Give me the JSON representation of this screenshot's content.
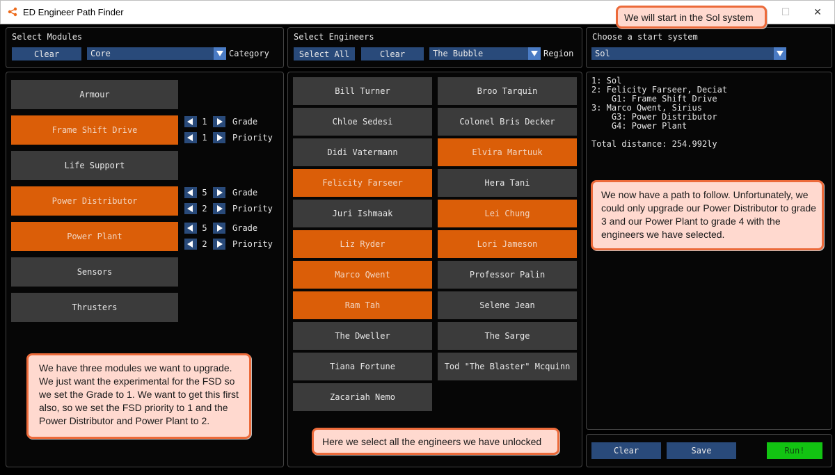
{
  "window": {
    "title": "ED Engineer Path Finder",
    "minimize": "—",
    "maximize": "☐",
    "close": "✕"
  },
  "modules_header": {
    "title": "Select Modules",
    "clear": "Clear",
    "category_value": "Core",
    "category_label": "Category"
  },
  "modules": [
    {
      "name": "Armour",
      "selected": false
    },
    {
      "name": "Frame Shift Drive",
      "selected": true,
      "grade": "1",
      "priority": "1"
    },
    {
      "name": "Life Support",
      "selected": false
    },
    {
      "name": "Power Distributor",
      "selected": true,
      "grade": "5",
      "priority": "2"
    },
    {
      "name": "Power Plant",
      "selected": true,
      "grade": "5",
      "priority": "2"
    },
    {
      "name": "Sensors",
      "selected": false
    },
    {
      "name": "Thrusters",
      "selected": false
    }
  ],
  "grade_label": "Grade",
  "priority_label": "Priority",
  "engineers_header": {
    "title": "Select Engineers",
    "select_all": "Select All",
    "clear": "Clear",
    "region_value": "The Bubble",
    "region_label": "Region"
  },
  "engineers": [
    {
      "name": "Bill Turner",
      "selected": false
    },
    {
      "name": "Broo Tarquin",
      "selected": false
    },
    {
      "name": "Chloe Sedesi",
      "selected": false
    },
    {
      "name": "Colonel Bris Decker",
      "selected": false
    },
    {
      "name": "Didi Vatermann",
      "selected": false
    },
    {
      "name": "Elvira Martuuk",
      "selected": true
    },
    {
      "name": "Felicity Farseer",
      "selected": true
    },
    {
      "name": "Hera Tani",
      "selected": false
    },
    {
      "name": "Juri Ishmaak",
      "selected": false
    },
    {
      "name": "Lei Chung",
      "selected": true
    },
    {
      "name": "Liz Ryder",
      "selected": true
    },
    {
      "name": "Lori Jameson",
      "selected": true
    },
    {
      "name": "Marco Qwent",
      "selected": true
    },
    {
      "name": "Professor Palin",
      "selected": false
    },
    {
      "name": "Ram Tah",
      "selected": true
    },
    {
      "name": "Selene Jean",
      "selected": false
    },
    {
      "name": "The Dweller",
      "selected": false
    },
    {
      "name": "The Sarge",
      "selected": false
    },
    {
      "name": "Tiana Fortune",
      "selected": false
    },
    {
      "name": "Tod \"The Blaster\" Mcquinn",
      "selected": false
    },
    {
      "name": "Zacariah Nemo",
      "selected": false
    }
  ],
  "start_system": {
    "title": "Choose a start system",
    "value": "Sol"
  },
  "result_lines": [
    "1: Sol",
    "2: Felicity Farseer, Deciat",
    "    G1: Frame Shift Drive",
    "3: Marco Qwent, Sirius",
    "    G3: Power Distributor",
    "    G4: Power Plant",
    "",
    "Total distance: 254.992ly"
  ],
  "bottom_buttons": {
    "clear": "Clear",
    "save": "Save",
    "run": "Run!"
  },
  "callouts": {
    "sol": "We will start in the Sol system",
    "path": "We now have a path to follow. Unfortunately, we could only upgrade our Power Distributor to grade 3 and our Power Plant to grade 4 with the engineers we have selected.",
    "modules": "We have three modules we want to upgrade. We just want the experimental for the FSD so we set the Grade to 1. We want to get this first also, so we set the FSD priority to 1 and the Power Distributor and Power Plant to 2.",
    "engineers": "Here we select all the engineers we have unlocked"
  },
  "colors": {
    "selected": "#db5e08",
    "unselected": "#3b3b3b",
    "accent_blue": "#294a7a",
    "run_green": "#12c312"
  }
}
